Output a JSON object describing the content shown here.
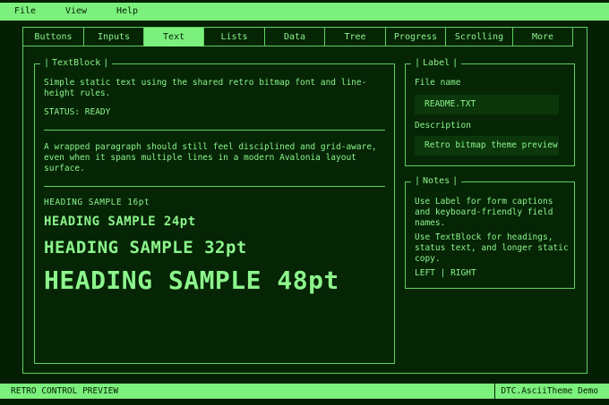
{
  "menu": [
    "File",
    "View",
    "Help"
  ],
  "tabs": [
    "Buttons",
    "Inputs",
    "Text",
    "Lists",
    "Data",
    "Tree",
    "Progress",
    "Scrolling",
    "More"
  ],
  "active_tab": "Text",
  "textblock": {
    "legend": "TextBlock",
    "intro": "Simple static text using the shared retro bitmap font and line-height rules.",
    "status": "STATUS: READY",
    "paragraph": "A wrapped paragraph should still feel disciplined and grid-aware, even when it spans multiple lines in a modern Avalonia layout surface.",
    "headings": [
      "HEADING SAMPLE 16pt",
      "HEADING SAMPLE 24pt",
      "HEADING SAMPLE 32pt",
      "HEADING SAMPLE 48pt"
    ]
  },
  "label_group": {
    "legend": "Label",
    "file_name_label": "File name",
    "file_name_value": "README.TXT",
    "description_label": "Description",
    "description_value": "Retro bitmap theme preview"
  },
  "notes": {
    "legend": "Notes",
    "line1": "Use Label for form captions and keyboard-friendly field names.",
    "line2": "Use TextBlock for headings, status text, and longer static copy.",
    "left": "LEFT",
    "right": "RIGHT"
  },
  "statusbar": {
    "left": "RETRO CONTROL PREVIEW",
    "right": "DTC.AsciiTheme Demo"
  },
  "colors": {
    "background": "#041f04",
    "accent": "#7cf07c",
    "text": "#8cf58c"
  }
}
